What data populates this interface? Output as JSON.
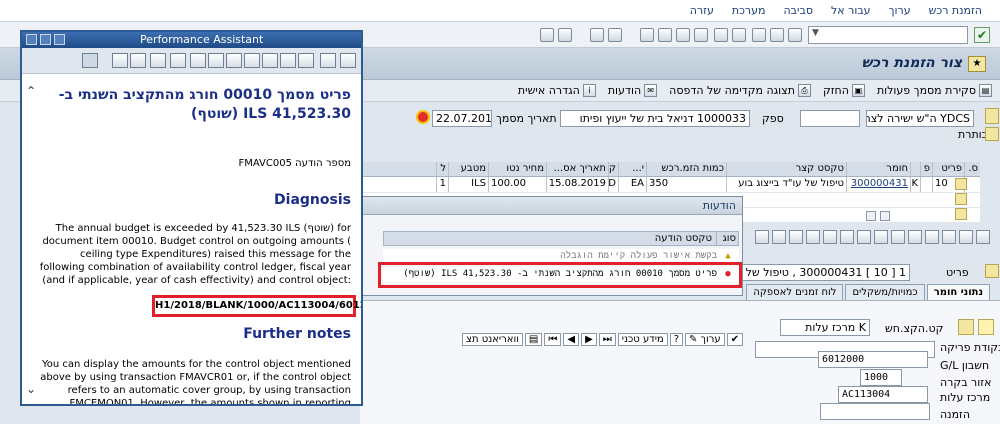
{
  "menubar": {
    "items": [
      "הזמנת רכש",
      "ערוך",
      "עבור אל",
      "סביבה",
      "מערכת",
      "עזרה"
    ]
  },
  "title": "צור הזמנת רכש",
  "apptoolbar": {
    "items": [
      "סקירת מסמך פעולות",
      "החזק",
      "תצוגה מקדימה של הדפסה",
      "הודעות",
      "הגדרה אישית"
    ]
  },
  "header": {
    "doc_type": "YDCS ה\"ש ישירה לצריכ",
    "vendor_label": "ספק",
    "vendor_value": "1000033 דניאל בית של ייעוץ ופיתו",
    "date_label": "תאריך מסמך",
    "date_value": "22.07.2019",
    "headings_label": "כותרת"
  },
  "table": {
    "columns": [
      "ס.",
      "פריט",
      "פ",
      "חומר",
      "טקסט קצר",
      "כמות הזמ.רכש",
      "י...",
      "ק",
      "תאריך אס...",
      "מחיר נטו",
      "מטבע",
      "ל"
    ],
    "row": {
      "item": "10",
      "k": "K",
      "material": "300000431",
      "short_text": "טיפול של עו\"ד בייצוג בוע",
      "qty": "350",
      "unit": "EA",
      "d": "D",
      "delivery_date": "15.08.2019",
      "net_price": "100.00",
      "currency": "ILS",
      "per": "1"
    }
  },
  "messages_dialog": {
    "title": "הודעות",
    "col_type": "סוג",
    "col_text": "טקסט הודעה",
    "row1_text": "בקשת אישור פעולה קיימת הוגבלה",
    "row2_text": "פריט מסמך 00010 חורג מהתקציב השנתי ב- ILS 41,523.30 (שוטף)"
  },
  "item_detail": {
    "item_label": "פריט",
    "item_value": "1 [ 10 ] 300000431 , טיפול של עו\"ד",
    "tabs": [
      "נתוני חומר",
      "כמויות/משקלים",
      "לוח זמנים לאספקה"
    ],
    "assignment_label": "קט.הקצ.חש",
    "assignment_value": "K מרכז עלות",
    "unloading_label": "נקודת פריקה",
    "gl_label": "חשבון G/L",
    "gl_value": "6012000",
    "area_label": "אזור בקרה",
    "area_value": "1000",
    "cc_label": "מרכז עלות",
    "cc_value": "AC113004",
    "order_label": "הזמנה"
  },
  "detail_toolbar": {
    "edit": "ערוך",
    "tech_info": "מידע טכני",
    "variant": "וואריאנט תצ"
  },
  "perf_assistant": {
    "window_title": "Performance Assistant",
    "heading": "פריט מסמך 00010 חורג מהתקציב השנתי ב- ILS 41,523.30 (שוטף)",
    "msg_number": "מספר הודעה FMAVC005",
    "diagnosis_title": "Diagnosis",
    "diagnosis_text": "The annual budget is exceeded by 41,523.30 ILS (שוטף) for document item 00010. Budget control on outgoing amounts ( ceiling type Expenditures) raised this message for the following combination of availability control ledger, fiscal year (and if applicable, year of cash effectivity) and control object:",
    "control_object": "H1/2018/BLANK/1000/AC113004/6012000",
    "further_title": "Further notes",
    "further_text": "You can display the amounts for the control object mentioned above by using transaction FMAVCR01 or, if the control object refers to an automatic cover group, by using transaction FMCEMON01. However, the amounts shown in reporting normally do not take into account the amounts of the current document."
  }
}
